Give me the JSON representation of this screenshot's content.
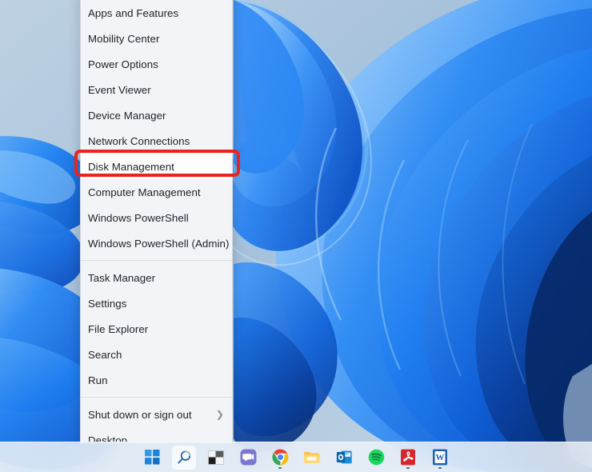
{
  "os": {
    "name": "Windows 11",
    "wallpaper_name": "bloom-wallpaper",
    "desktop_bg_color": "#a6c1da",
    "accent_color": "#0a66c2"
  },
  "annotation": {
    "shape": "rounded-rectangle",
    "color": "#e8241f",
    "target_label": "Disk Management",
    "stroke_width_px": 4
  },
  "winx_menu": {
    "name": "Win+X quick link menu",
    "groups": [
      {
        "items": [
          {
            "label": "Apps and Features",
            "submenu": false
          },
          {
            "label": "Mobility Center",
            "submenu": false
          },
          {
            "label": "Power Options",
            "submenu": false
          },
          {
            "label": "Event Viewer",
            "submenu": false
          },
          {
            "label": "Device Manager",
            "submenu": false
          },
          {
            "label": "Network Connections",
            "submenu": false
          },
          {
            "label": "Disk Management",
            "submenu": false,
            "highlighted": true
          },
          {
            "label": "Computer Management",
            "submenu": false
          },
          {
            "label": "Windows PowerShell",
            "submenu": false
          },
          {
            "label": "Windows PowerShell (Admin)",
            "submenu": false
          }
        ]
      },
      {
        "items": [
          {
            "label": "Task Manager",
            "submenu": false
          },
          {
            "label": "Settings",
            "submenu": false
          },
          {
            "label": "File Explorer",
            "submenu": false
          },
          {
            "label": "Search",
            "submenu": false
          },
          {
            "label": "Run",
            "submenu": false
          }
        ]
      },
      {
        "items": [
          {
            "label": "Shut down or sign out",
            "submenu": true,
            "chevron": "❯"
          },
          {
            "label": "Desktop",
            "submenu": false
          }
        ]
      }
    ]
  },
  "taskbar": {
    "items": [
      {
        "icon": "start-windows-icon",
        "label": "Start",
        "active": false,
        "running": false
      },
      {
        "icon": "search-icon",
        "label": "Search",
        "active": true,
        "running": false
      },
      {
        "icon": "task-view-icon",
        "label": "Task View",
        "active": false,
        "running": false
      },
      {
        "icon": "microsoft-teams-chat-icon",
        "label": "Chat",
        "active": false,
        "running": false
      },
      {
        "icon": "google-chrome-icon",
        "label": "Google Chrome",
        "active": false,
        "running": true
      },
      {
        "icon": "file-explorer-icon",
        "label": "File Explorer",
        "active": false,
        "running": false
      },
      {
        "icon": "microsoft-outlook-icon",
        "label": "Outlook",
        "active": false,
        "running": false
      },
      {
        "icon": "spotify-icon",
        "label": "Spotify",
        "active": false,
        "running": false
      },
      {
        "icon": "adobe-acrobat-reader-icon",
        "label": "Adobe Acrobat Reader",
        "active": false,
        "running": true
      },
      {
        "icon": "microsoft-word-icon",
        "label": "Microsoft Word",
        "active": false,
        "running": true
      }
    ]
  }
}
